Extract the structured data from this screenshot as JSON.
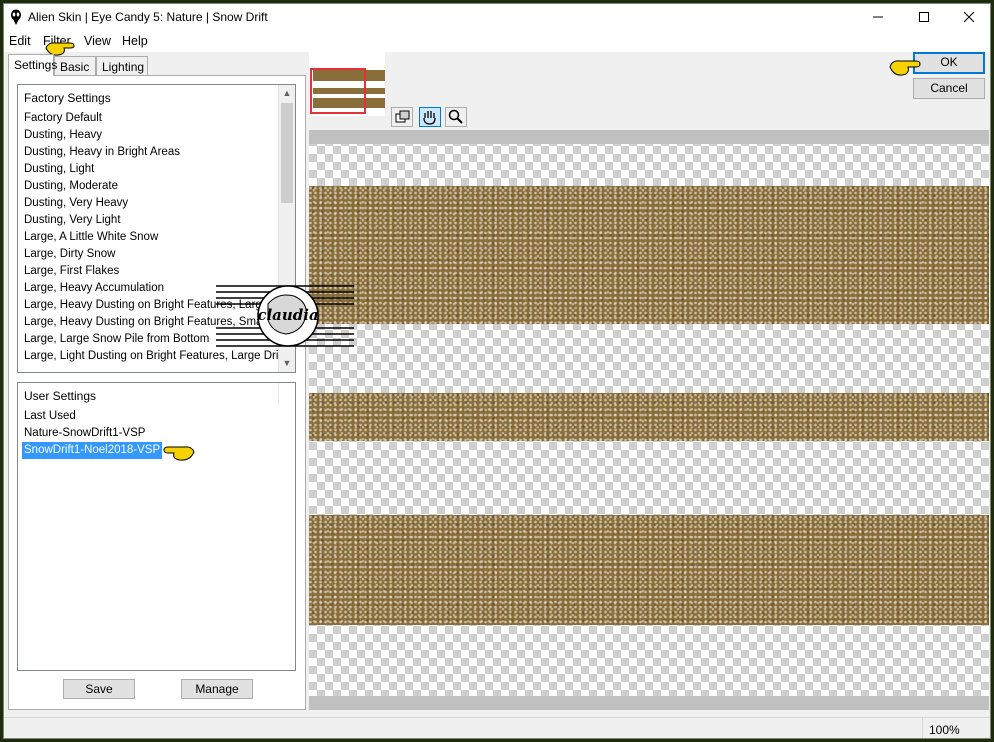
{
  "window": {
    "title": "Alien Skin | Eye Candy 5: Nature | Snow Drift",
    "controls": [
      "minimize",
      "maximize",
      "close"
    ]
  },
  "menu": [
    "Edit",
    "Filter",
    "View",
    "Help"
  ],
  "tabs": [
    "Settings",
    "Basic",
    "Lighting"
  ],
  "factory_settings": {
    "header": "Factory Settings",
    "items": [
      "Factory Default",
      "Dusting, Heavy",
      "Dusting, Heavy in Bright Areas",
      "Dusting, Light",
      "Dusting, Moderate",
      "Dusting, Very Heavy",
      "Dusting, Very Light",
      "Large, A Little White Snow",
      "Large, Dirty Snow",
      "Large, First Flakes",
      "Large, Heavy Accumulation",
      "Large, Heavy Dusting on Bright Features, Large Drift",
      "Large, Heavy Dusting on Bright Features, Small Drift",
      "Large, Large Snow Pile from Bottom",
      "Large, Light Dusting on Bright Features, Large Drift"
    ]
  },
  "user_settings": {
    "header": "User Settings",
    "items": [
      "Last Used",
      "Nature-SnowDrift1-VSP",
      "SnowDrift1-Noel2018-VSP"
    ],
    "selected": "SnowDrift1-Noel2018-VSP"
  },
  "buttons": {
    "save": "Save",
    "manage": "Manage",
    "ok": "OK",
    "cancel": "Cancel"
  },
  "tools": [
    "navigate-icon",
    "hand-icon",
    "zoom-icon"
  ],
  "status": {
    "zoom": "100%"
  },
  "watermark_text": "claudia",
  "colors": {
    "snow": "#8a6e3a",
    "selection": "#3399ff",
    "accent": "#0078d7",
    "pointer": "#f5d200"
  }
}
